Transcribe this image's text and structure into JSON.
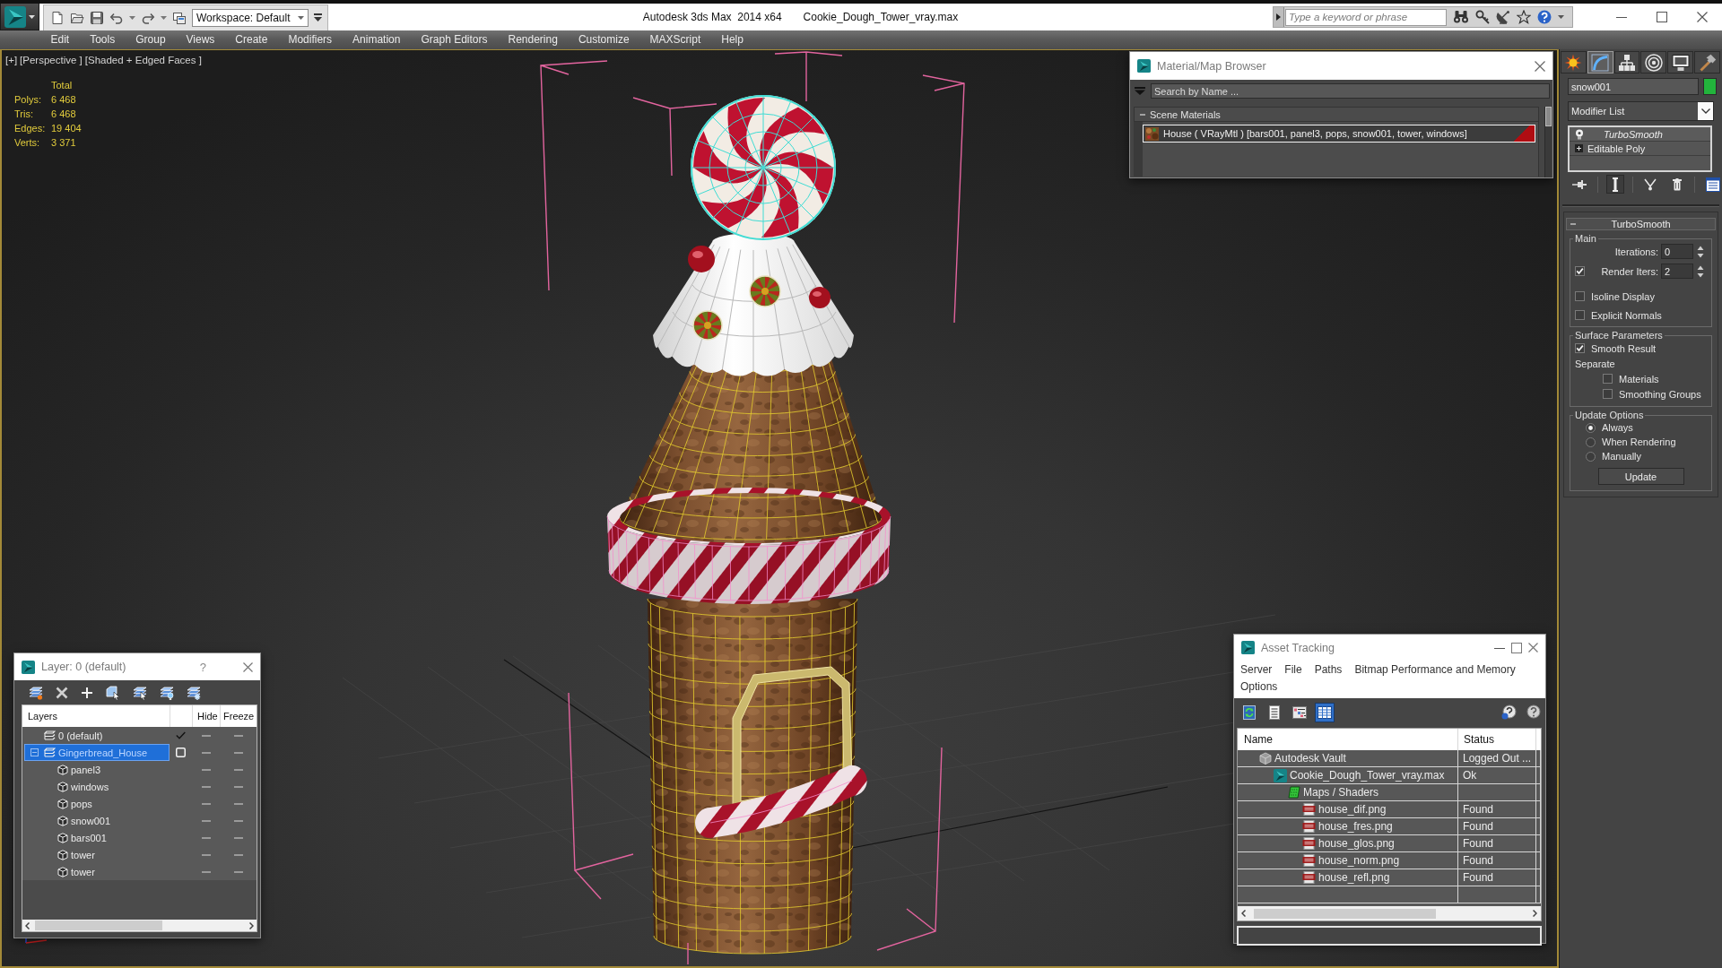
{
  "title_bar": {
    "workspace": "Workspace: Default",
    "app_title": "Autodesk 3ds Max  2014 x64",
    "file_name": "Cookie_Dough_Tower_vray.max",
    "search": {
      "placeholder": "Type a keyword or phrase"
    }
  },
  "menu_bar": [
    "Edit",
    "Tools",
    "Group",
    "Views",
    "Create",
    "Modifiers",
    "Animation",
    "Graph Editors",
    "Rendering",
    "Customize",
    "MAXScript",
    "Help"
  ],
  "viewport": {
    "labels": [
      "[+]",
      "[Perspective ]",
      "[Shaded + Edged Faces ]"
    ],
    "stats": {
      "heading": "Total",
      "rows": [
        {
          "label": "Polys:",
          "value": "6 468"
        },
        {
          "label": "Tris:",
          "value": "6 468"
        },
        {
          "label": "Edges:",
          "value": "19 404"
        },
        {
          "label": "Verts:",
          "value": "3 371"
        }
      ]
    }
  },
  "material_browser": {
    "title": "Material/Map Browser",
    "search": {
      "placeholder": "Search by Name ..."
    },
    "groups": [
      {
        "label": "Scene Materials",
        "expanded": true,
        "items": [
          {
            "name": "House ( VRayMtl ) [bars001, panel3, pops, snow001, tower, windows]",
            "selected": true
          }
        ]
      }
    ]
  },
  "command_panel": {
    "tabs": [
      {
        "kind": "create",
        "selected": false
      },
      {
        "kind": "modify",
        "selected": true
      },
      {
        "kind": "hierarchy",
        "selected": false
      },
      {
        "kind": "motion",
        "selected": false
      },
      {
        "kind": "display",
        "selected": false
      },
      {
        "kind": "utilities",
        "selected": false
      }
    ],
    "object_name": "snow001",
    "modifier_list": "Modifier List",
    "stack": [
      {
        "name": "TurboSmooth",
        "kind": "modifier"
      },
      {
        "name": "Editable Poly",
        "kind": "base"
      }
    ],
    "stack_tools": [
      {
        "kind": "pin",
        "on": false
      },
      {
        "kind": "show_end_result",
        "on": true
      },
      {
        "kind": "make_unique",
        "on": false
      },
      {
        "kind": "remove",
        "on": false
      },
      {
        "kind": "configure",
        "on": false
      }
    ],
    "rollout": {
      "title": "TurboSmooth",
      "expanded": true,
      "main": {
        "title": "Main",
        "iterations": {
          "label": "Iterations:",
          "value": "0"
        },
        "render_iters": {
          "label": "Render Iters:",
          "value": "2",
          "checked": true
        },
        "options": [
          {
            "label": "Isoline Display",
            "checked": false
          },
          {
            "label": "Explicit Normals",
            "checked": false
          }
        ]
      },
      "surface_parameters": {
        "title": "Surface Parameters",
        "smooth_result": {
          "label": "Smooth Result",
          "checked": true
        },
        "separate": {
          "label": "Separate",
          "options": [
            {
              "label": "Materials",
              "checked": false
            },
            {
              "label": "Smoothing Groups",
              "checked": false
            }
          ]
        }
      },
      "update_options": {
        "title": "Update Options",
        "modes": [
          {
            "label": "Always",
            "selected": true
          },
          {
            "label": "When Rendering",
            "selected": false
          },
          {
            "label": "Manually",
            "selected": false
          }
        ],
        "button": "Update"
      }
    }
  },
  "layer_dialog": {
    "title": "Layer: 0 (default)",
    "help": "?",
    "columns": {
      "name": "Layers",
      "hide": "Hide",
      "freeze": "Freeze"
    },
    "layers": [
      {
        "name": "0 (default)",
        "current": true,
        "selected": false,
        "hidden": false,
        "frozen": false
      },
      {
        "name": "Gingerbread_House",
        "current": false,
        "selected": true,
        "expanded": true,
        "hidden": false,
        "frozen": false,
        "children": [
          {
            "name": "panel3",
            "selected": false,
            "hidden": false,
            "frozen": false
          },
          {
            "name": "windows",
            "selected": false,
            "hidden": false,
            "frozen": false
          },
          {
            "name": "pops",
            "selected": false,
            "hidden": false,
            "frozen": false
          },
          {
            "name": "snow001",
            "selected": false,
            "hidden": false,
            "frozen": false
          },
          {
            "name": "bars001",
            "selected": false,
            "hidden": false,
            "frozen": false
          },
          {
            "name": "tower",
            "selected": false,
            "hidden": false,
            "frozen": false
          },
          {
            "name": "tower",
            "selected": false,
            "hidden": false,
            "frozen": false
          }
        ]
      }
    ]
  },
  "asset_tracking": {
    "title": "Asset Tracking",
    "menu": [
      "Server",
      "File",
      "Paths",
      "Bitmap Performance and Memory",
      "Options"
    ],
    "toolbar": [
      {
        "kind": "refresh",
        "selected": false
      },
      {
        "kind": "list",
        "selected": false
      },
      {
        "kind": "tree",
        "selected": false
      },
      {
        "kind": "table",
        "selected": true
      }
    ],
    "columns": {
      "name": "Name",
      "status": "Status"
    },
    "tree": [
      {
        "kind": "vault",
        "name": "Autodesk Vault",
        "status": "Logged Out ...",
        "children": [
          {
            "kind": "max_file",
            "name": "Cookie_Dough_Tower_vray.max",
            "status": "Ok",
            "children": [
              {
                "kind": "folder",
                "name": "Maps / Shaders",
                "children": [
                  {
                    "kind": "png",
                    "name": "house_dif.png",
                    "status": "Found"
                  },
                  {
                    "kind": "png",
                    "name": "house_fres.png",
                    "status": "Found"
                  },
                  {
                    "kind": "png",
                    "name": "house_glos.png",
                    "status": "Found"
                  },
                  {
                    "kind": "png",
                    "name": "house_norm.png",
                    "status": "Found"
                  },
                  {
                    "kind": "png",
                    "name": "house_refl.png",
                    "status": "Found"
                  }
                ]
              }
            ]
          }
        ]
      }
    ]
  }
}
